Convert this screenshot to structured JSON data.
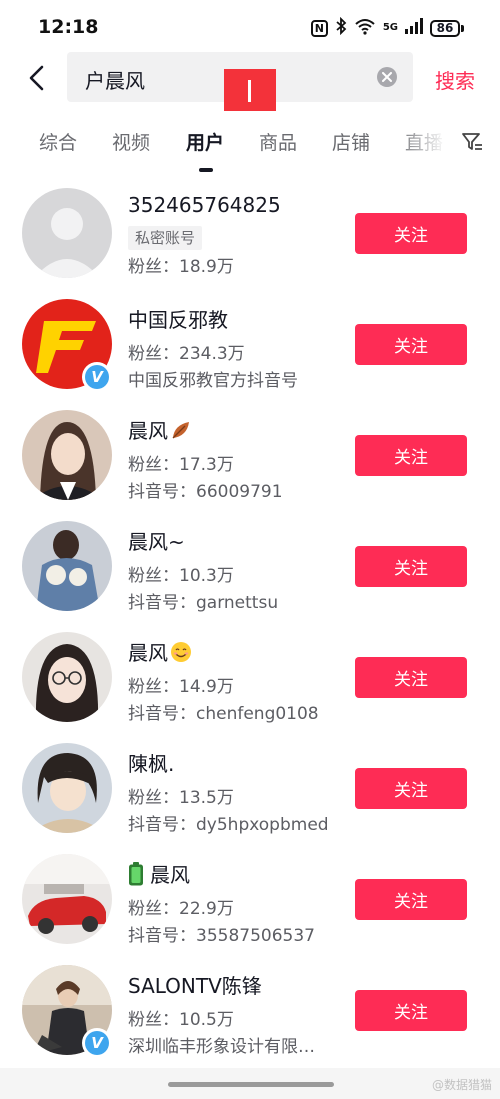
{
  "status_bar": {
    "time": "12:18",
    "icons": [
      "nfc-icon",
      "bluetooth-icon",
      "wifi-icon",
      "signal-icon",
      "battery-icon"
    ],
    "network": "5G",
    "wifi_label": "6",
    "battery_level": "86"
  },
  "search": {
    "query": "户晨风",
    "submit_label": "搜索"
  },
  "tabs": [
    {
      "label": "综合"
    },
    {
      "label": "视频"
    },
    {
      "label": "用户"
    },
    {
      "label": "商品"
    },
    {
      "label": "店铺"
    },
    {
      "label": "直播"
    }
  ],
  "active_tab": "用户",
  "users": [
    {
      "name": "352465764825",
      "tag": "私密账号",
      "line1": "粉丝：18.9万",
      "line2": "",
      "follow_label": "关注",
      "verified": false
    },
    {
      "name": "中国反邪教",
      "line1": "粉丝：234.3万",
      "line2": "中国反邪教官方抖音号",
      "follow_label": "关注",
      "verified": true
    },
    {
      "name": "晨风",
      "name_icon": "fallen-leaf-icon",
      "line1": "粉丝：17.3万",
      "line2": "抖音号：66009791",
      "follow_label": "关注",
      "verified": false
    },
    {
      "name": "晨风~",
      "line1": "粉丝：10.3万",
      "line2": "抖音号：garnettsu",
      "follow_label": "关注",
      "verified": false
    },
    {
      "name": "晨风",
      "name_icon": "smiling-face-icon",
      "line1": "粉丝：14.9万",
      "line2": "抖音号：chenfeng0108",
      "follow_label": "关注",
      "verified": false
    },
    {
      "name": "陳枫.",
      "line1": "粉丝：13.5万",
      "line2": "抖音号：dy5hpxopbmed",
      "follow_label": "关注",
      "verified": false
    },
    {
      "name": "晨风",
      "name_prefix_icon": "battery-icon",
      "line1": "粉丝：22.9万",
      "line2": "抖音号：35587506537",
      "follow_label": "关注",
      "verified": false
    },
    {
      "name": "SALONTV陈锋",
      "line1": "粉丝：10.5万",
      "line2": "深圳临丰形象设计有限…",
      "follow_label": "关注",
      "verified": true
    }
  ],
  "watermark": "@数据猎猫",
  "colors": {
    "accent": "#fe2c55",
    "text_primary": "#161823",
    "text_secondary": "#5c5d63",
    "search_bg": "#f1f1f2",
    "verified_blue": "#3ea5ee",
    "redaction_red": "#f3323a"
  }
}
